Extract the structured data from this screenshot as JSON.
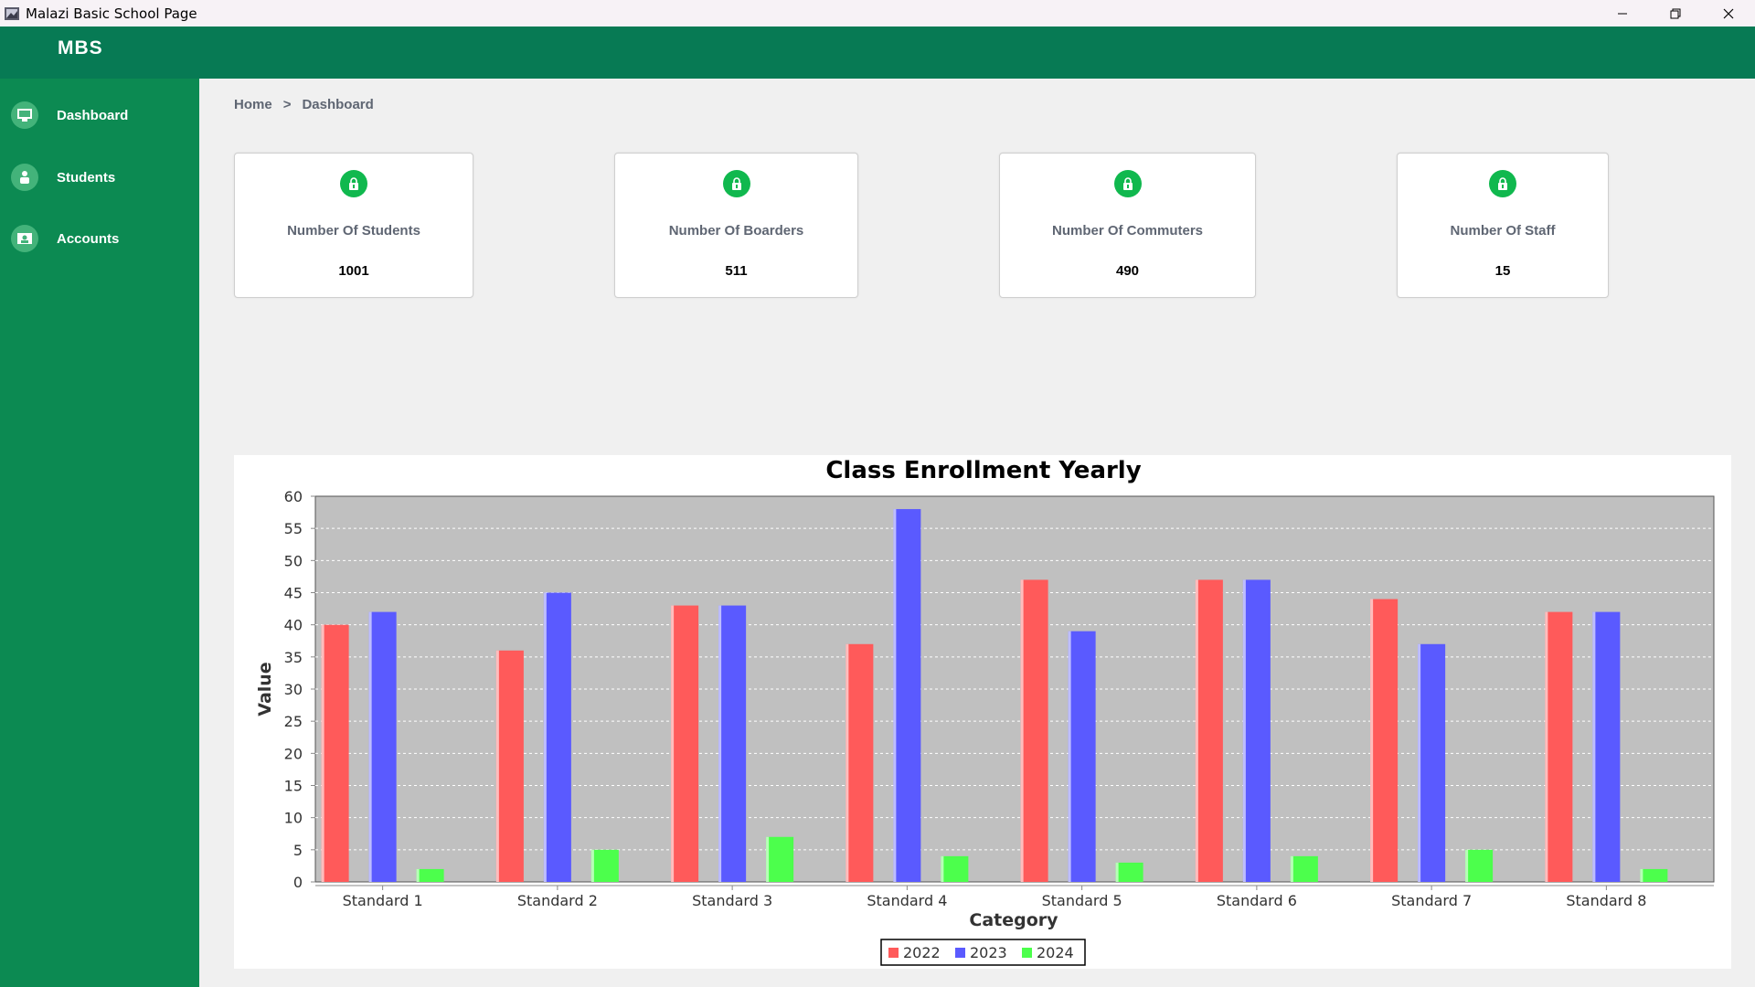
{
  "window": {
    "title": "Malazi Basic School Page"
  },
  "header": {
    "brand": "MBS"
  },
  "sidebar": {
    "items": [
      {
        "label": "Dashboard",
        "icon": "dashboard-icon"
      },
      {
        "label": "Students",
        "icon": "student-icon"
      },
      {
        "label": "Accounts",
        "icon": "accounts-icon"
      }
    ]
  },
  "breadcrumb": {
    "home": "Home",
    "separator": ">",
    "current": "Dashboard"
  },
  "cards": [
    {
      "label": "Number Of Students",
      "value": "1001",
      "icon": "lock-icon"
    },
    {
      "label": "Number Of Boarders",
      "value": "511",
      "icon": "lock-icon"
    },
    {
      "label": "Number Of Commuters",
      "value": "490",
      "icon": "lock-icon"
    },
    {
      "label": "Number Of Staff",
      "value": "15",
      "icon": "lock-icon"
    }
  ],
  "colors": {
    "header": "#077a54",
    "sidebar": "#0c8a52",
    "card_icon": "#10b84e",
    "plot_bg": "#c0c0c0"
  },
  "chart_data": {
    "type": "bar",
    "title": "Class Enrollment Yearly",
    "xlabel": "Category",
    "ylabel": "Value",
    "ylim": [
      0,
      60
    ],
    "yticks": [
      0,
      5,
      10,
      15,
      20,
      25,
      30,
      35,
      40,
      45,
      50,
      55,
      60
    ],
    "grid": true,
    "legend_position": "bottom",
    "categories": [
      "Standard 1",
      "Standard 2",
      "Standard 3",
      "Standard 4",
      "Standard 5",
      "Standard 6",
      "Standard 7",
      "Standard 8"
    ],
    "series": [
      {
        "name": "2022",
        "color": "#ff5a5a",
        "values": [
          40,
          36,
          43,
          37,
          47,
          47,
          44,
          42
        ]
      },
      {
        "name": "2023",
        "color": "#5a5aff",
        "values": [
          42,
          45,
          43,
          58,
          39,
          47,
          37,
          42
        ]
      },
      {
        "name": "2024",
        "color": "#4cff4c",
        "values": [
          2,
          5,
          7,
          4,
          3,
          4,
          5,
          2
        ]
      }
    ]
  }
}
